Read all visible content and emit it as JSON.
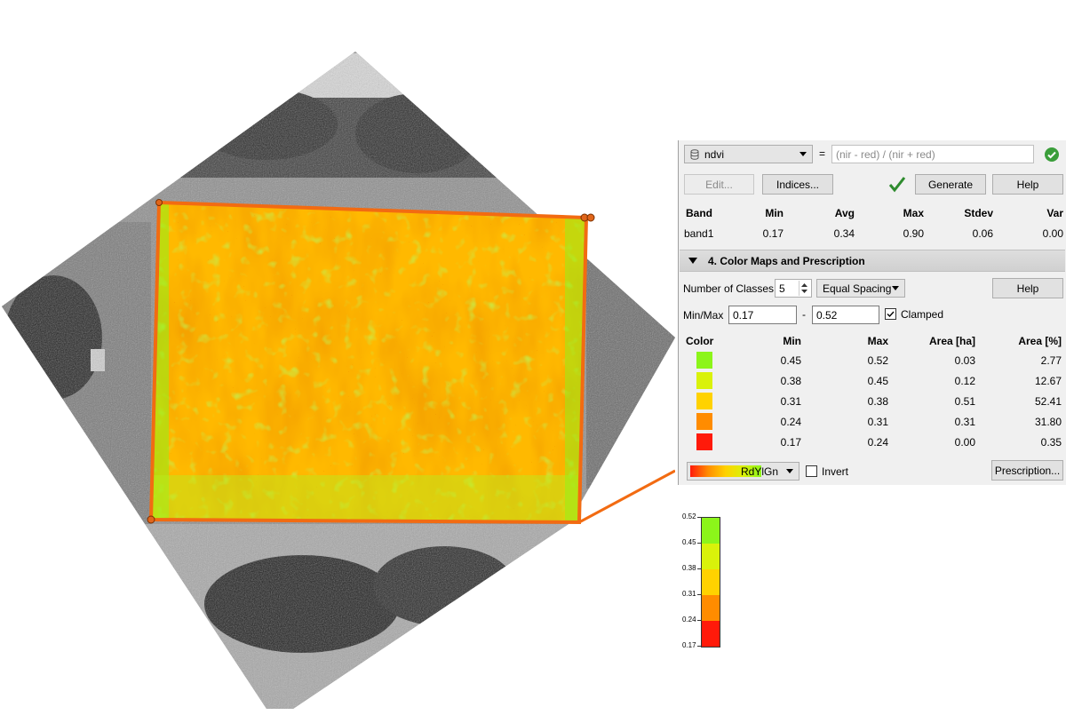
{
  "formula_panel": {
    "index_name": "ndvi",
    "equals": "=",
    "expression": "(nir - red) / (nir + red)",
    "edit_label": "Edit...",
    "indices_label": "Indices...",
    "generate_label": "Generate",
    "help_label": "Help"
  },
  "stats": {
    "headers": [
      "Band",
      "Min",
      "Avg",
      "Max",
      "Stdev",
      "Var"
    ],
    "row": [
      "band1",
      "0.17",
      "0.34",
      "0.90",
      "0.06",
      "0.00"
    ]
  },
  "color_maps": {
    "section_title": "4. Color Maps and Prescription",
    "classes_label": "Number of Classes",
    "classes_value": "5",
    "spacing": "Equal Spacing",
    "help_label": "Help",
    "minmax_label": "Min/Max",
    "min_value": "0.17",
    "dash": "-",
    "max_value": "0.52",
    "clamped_label": "Clamped",
    "clamped_checked": true,
    "table_headers": [
      "Color",
      "Min",
      "Max",
      "Area [ha]",
      "Area [%]"
    ],
    "rows": [
      {
        "color": "#8cf51a",
        "min": "0.45",
        "max": "0.52",
        "area_ha": "0.03",
        "area_pct": "2.77"
      },
      {
        "color": "#d9f20a",
        "min": "0.38",
        "max": "0.45",
        "area_ha": "0.12",
        "area_pct": "12.67"
      },
      {
        "color": "#ffd200",
        "min": "0.31",
        "max": "0.38",
        "area_ha": "0.51",
        "area_pct": "52.41"
      },
      {
        "color": "#ff8c00",
        "min": "0.24",
        "max": "0.31",
        "area_ha": "0.31",
        "area_pct": "31.80"
      },
      {
        "color": "#ff1a0a",
        "min": "0.17",
        "max": "0.24",
        "area_ha": "0.00",
        "area_pct": "0.35"
      }
    ],
    "ramp_name": "RdYlGn",
    "invert_label": "Invert",
    "invert_checked": false,
    "prescription_label": "Prescription..."
  },
  "legend": {
    "ticks": [
      "0.52",
      "0.45",
      "0.38",
      "0.31",
      "0.24",
      "0.17"
    ],
    "colors": [
      "#8cf51a",
      "#d9f20a",
      "#ffd200",
      "#ff8c00",
      "#ff1a0a"
    ]
  },
  "map": {
    "field_outline_color": "#f26b12",
    "vertex_color": "#e0651a"
  },
  "colors": {
    "ok_green": "#3a9e3a",
    "accent": "#f26b12"
  }
}
